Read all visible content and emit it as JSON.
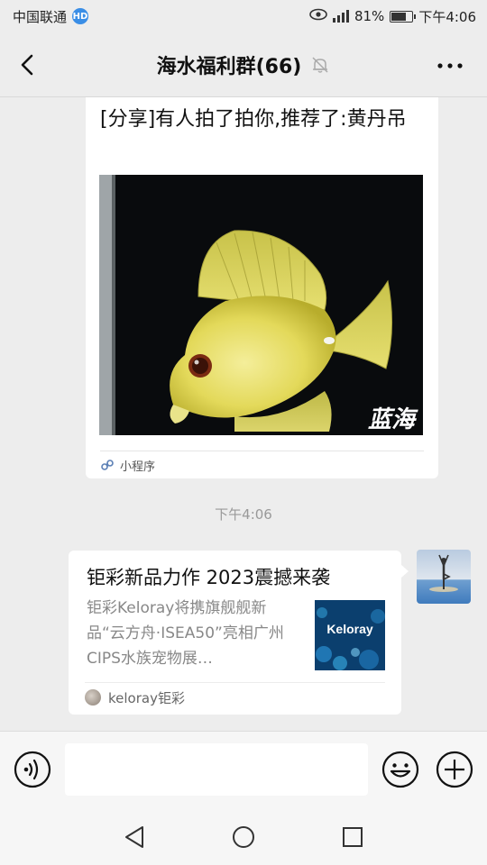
{
  "status_bar": {
    "carrier": "中国联通",
    "hd_badge": "HD",
    "battery_text": "81%",
    "battery_level": 0.81,
    "time": "下午4:06"
  },
  "header": {
    "title": "海水福利群(66)"
  },
  "messages": {
    "mini_program_card": {
      "title": "[分享]有人拍了拍你,推荐了:黄丹吊",
      "image_watermark": "蓝海",
      "source_label": "小程序"
    },
    "timestamp": "下午4:06",
    "article_card": {
      "title": "钜彩新品力作 2023震撼来袭",
      "description": "钜彩Keloray将携旗舰舰新品“云方舟·ISEA50”亮相广州CIPS水族宠物展…",
      "thumbnail_text": "Keloray",
      "source_name": "keloray钜彩"
    }
  },
  "input_bar": {
    "placeholder": ""
  },
  "icons": {
    "back": "chevron-left-icon",
    "mute": "bell-off-icon",
    "more": "more-dots-icon",
    "voice": "voice-icon",
    "emoji": "emoji-icon",
    "plus": "plus-icon"
  }
}
